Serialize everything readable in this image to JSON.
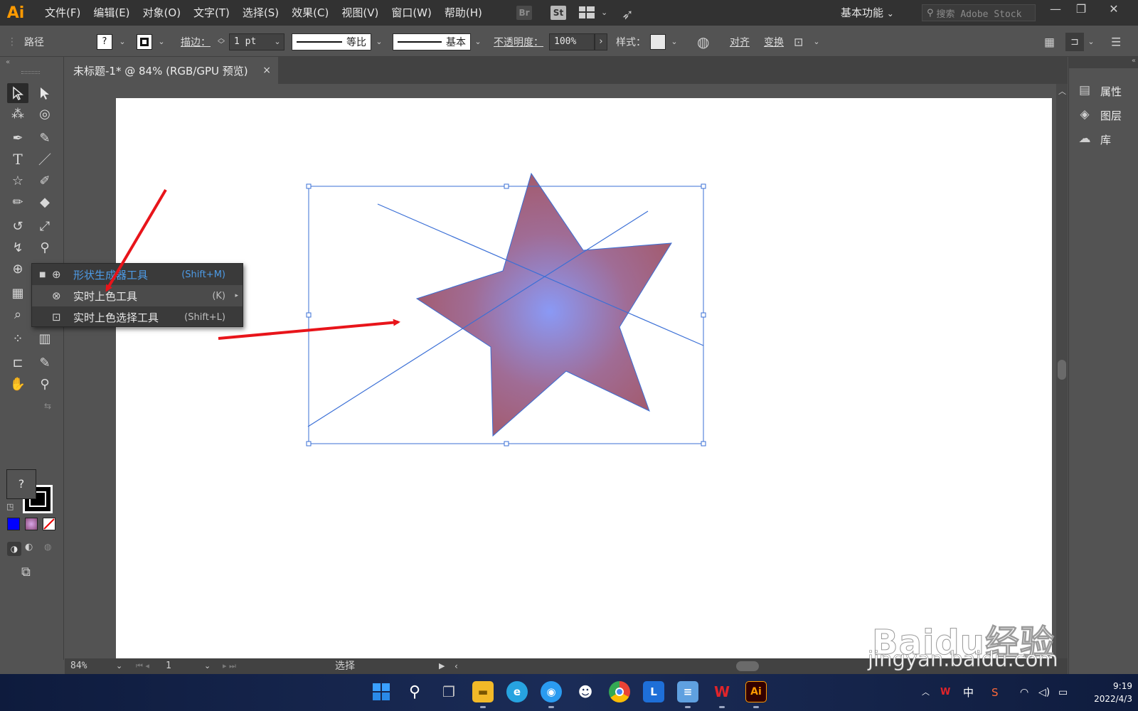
{
  "app": {
    "logo": "Ai",
    "menu": [
      "文件(F)",
      "编辑(E)",
      "对象(O)",
      "文字(T)",
      "选择(S)",
      "效果(C)",
      "视图(V)",
      "窗口(W)",
      "帮助(H)"
    ],
    "bridge_label": "Br",
    "stock_label": "St",
    "workspace": "基本功能",
    "search_placeholder": "搜索 Adobe Stock",
    "window_buttons": [
      "—",
      "❐",
      "✕"
    ]
  },
  "control_bar": {
    "selection_label": "路径",
    "fill_swatch": "?",
    "stroke_label": "描边：",
    "stroke_weight": "1 pt",
    "profile_label": "等比",
    "brush_label": "基本",
    "opacity_label": "不透明度：",
    "opacity_value": "100%",
    "style_label": "样式：",
    "align_label": "对齐",
    "transform_label": "变换"
  },
  "document": {
    "tab_title": "未标题-1* @ 84% (RGB/GPU 预览)",
    "tab_close": "×",
    "zoom": "84%",
    "artboard_number": "1",
    "status_tool": "选择"
  },
  "flyout": {
    "items": [
      {
        "label": "形状生成器工具",
        "shortcut": "(Shift+M)",
        "state": "selected"
      },
      {
        "label": "实时上色工具",
        "shortcut": "(K)",
        "state": "hover"
      },
      {
        "label": "实时上色选择工具",
        "shortcut": "(Shift+L)",
        "state": "normal"
      }
    ]
  },
  "tools": {
    "fill_swatch": "?"
  },
  "right_panel": {
    "items": [
      {
        "label": "属性",
        "icon": "properties-icon"
      },
      {
        "label": "图层",
        "icon": "layers-icon"
      },
      {
        "label": "库",
        "icon": "libraries-icon"
      }
    ]
  },
  "taskbar": {
    "ime": "中",
    "time": "9:19",
    "date": "2022/4/3",
    "ai_label": "Ai"
  },
  "watermark": {
    "brand": "Baidu经验",
    "url": "jingyan.baidu.com"
  },
  "colors": {
    "accent_blue": "#4d9be6",
    "selection_blue": "#3a6fd6",
    "star_outer": "#a35a6c",
    "star_center": "#8a99f5",
    "arrow_red": "#e8141a",
    "ai_orange": "#ff9a00"
  }
}
